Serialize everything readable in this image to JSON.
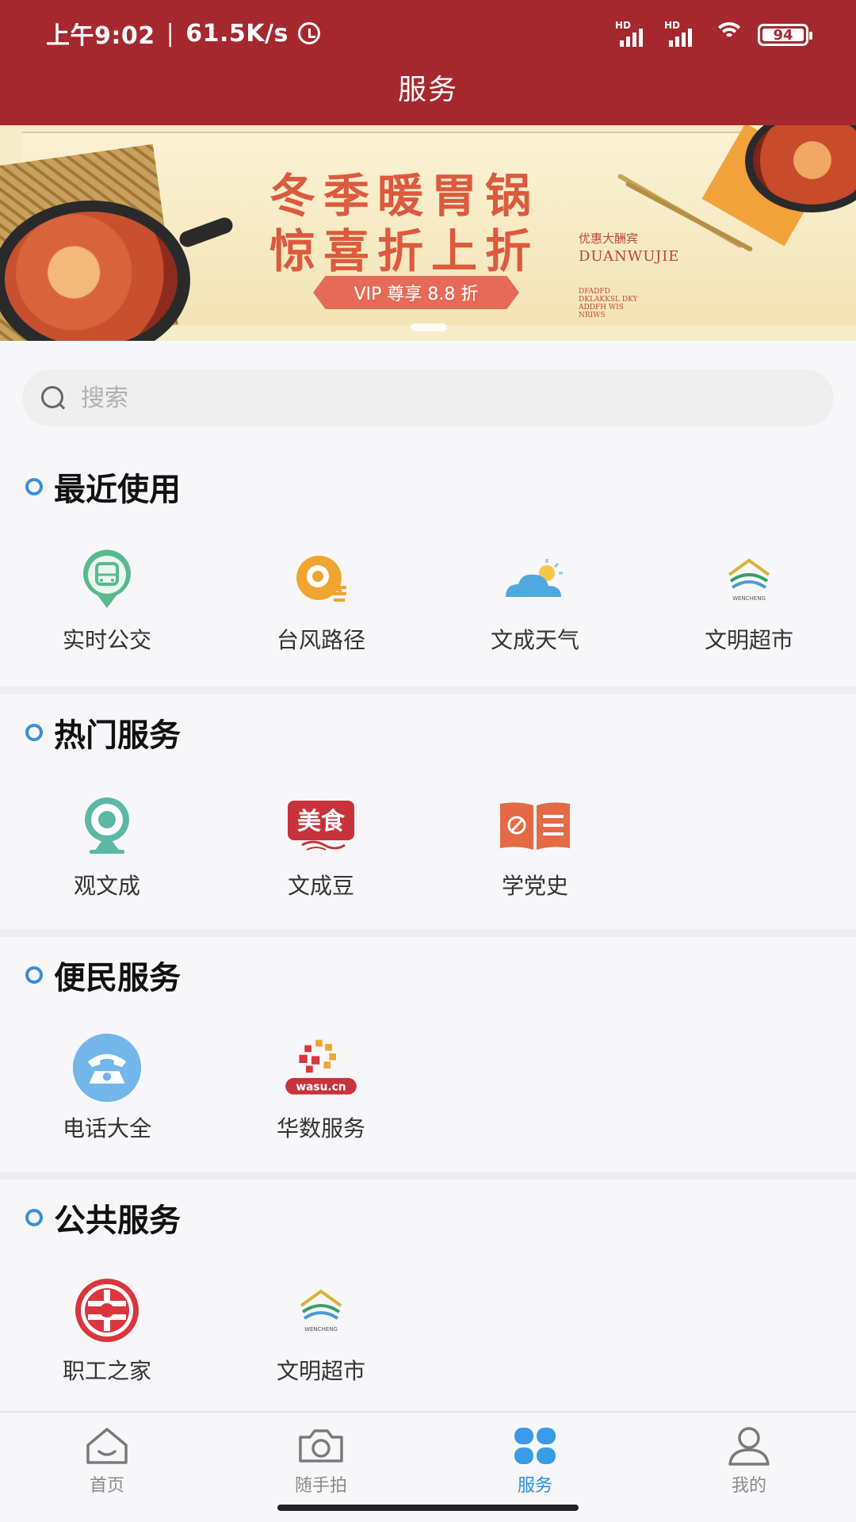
{
  "status_bar": {
    "time": "上午9:02",
    "speed": "61.5K/s",
    "battery": "94",
    "network_badge": "HD"
  },
  "header": {
    "title": "服务"
  },
  "banner": {
    "line1": "冬季暖胃锅",
    "line2": "惊喜折上折",
    "vip": "VIP 尊享 8.8 折",
    "brand_cn": "优惠大酬宾",
    "brand_en": "DUANWUJIE",
    "small_lines": [
      "DFADFD",
      "DKLAKKSL DKY",
      "ADDFH WIS",
      "NRIWS"
    ]
  },
  "search": {
    "placeholder": "搜索"
  },
  "sections": [
    {
      "title": "最近使用",
      "items": [
        {
          "label": "实时公交",
          "icon": "bus-pin-icon"
        },
        {
          "label": "台风路径",
          "icon": "typhoon-icon"
        },
        {
          "label": "文成天气",
          "icon": "weather-icon"
        },
        {
          "label": "文明超市",
          "icon": "wencheng-logo-icon",
          "logo_text": "WENCHENG"
        }
      ]
    },
    {
      "title": "热门服务",
      "items": [
        {
          "label": "观文成",
          "icon": "webcam-icon"
        },
        {
          "label": "文成豆",
          "icon": "meishi-icon",
          "logo_text": "美食"
        },
        {
          "label": "学党史",
          "icon": "party-book-icon"
        }
      ]
    },
    {
      "title": "便民服务",
      "items": [
        {
          "label": "电话大全",
          "icon": "telephone-icon"
        },
        {
          "label": "华数服务",
          "icon": "wasu-icon",
          "logo_text": "wasu.cn"
        }
      ]
    },
    {
      "title": "公共服务",
      "items": [
        {
          "label": "职工之家",
          "icon": "union-icon"
        },
        {
          "label": "文明超市",
          "icon": "wencheng-logo-icon",
          "logo_text": "WENCHENG"
        }
      ]
    }
  ],
  "bottom_nav": [
    {
      "label": "首页",
      "icon": "home-icon",
      "active": false
    },
    {
      "label": "随手拍",
      "icon": "camera-icon",
      "active": false
    },
    {
      "label": "服务",
      "icon": "services-grid-icon",
      "active": true
    },
    {
      "label": "我的",
      "icon": "profile-icon",
      "active": false
    }
  ],
  "colors": {
    "header": "#a5282f",
    "accent": "#2c8ee0",
    "ring": "#3b8fd6"
  }
}
